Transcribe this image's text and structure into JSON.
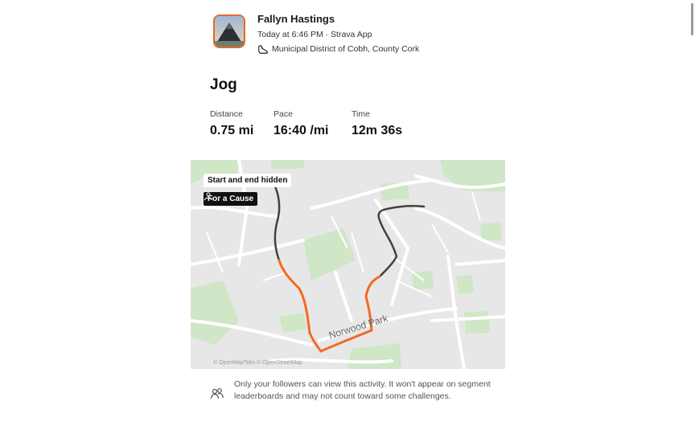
{
  "athlete": {
    "name": "Fallyn Hastings",
    "meta": "Today at 6:46 PM · Strava App",
    "location": "Municipal District of Cobh, County Cork",
    "avatar_icon": "mountain-avatar-icon"
  },
  "activity": {
    "title": "Jog"
  },
  "stats": [
    {
      "label": "Distance",
      "value": "0.75 mi"
    },
    {
      "label": "Pace",
      "value": "16:40 /mi"
    },
    {
      "label": "Time",
      "value": "12m 36s"
    }
  ],
  "map": {
    "start_end_label": "Start and end hidden",
    "cause_label": "For a Cause",
    "street_label": "Norwood Park",
    "attribution": "© OpenMapTiles © OpenStreetMap",
    "route_color": "#f26a21",
    "hidden_route_color": "#4a3f3a"
  },
  "privacy": {
    "text": "Only your followers can view this activity. It won't appear on segment leaderboards and may not count toward some challenges.",
    "icon": "people-icon"
  }
}
